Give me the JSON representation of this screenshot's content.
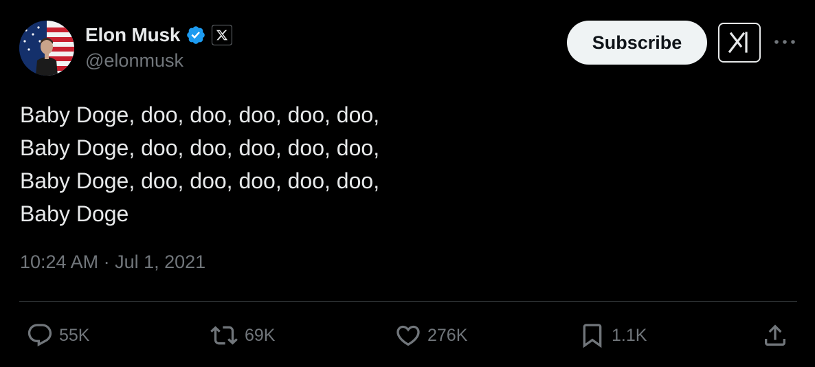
{
  "author": {
    "display_name": "Elon Musk",
    "handle": "@elonmusk",
    "verified_icon": "verified-badge-icon",
    "affiliate_icon": "x-logo-icon"
  },
  "header_actions": {
    "subscribe_label": "Subscribe",
    "grok_icon": "grok-icon",
    "more_icon": "more-dots-icon"
  },
  "tweet": {
    "text": "Baby Doge, doo, doo, doo, doo, doo,\nBaby Doge, doo, doo, doo, doo, doo,\nBaby Doge, doo, doo, doo, doo, doo,\nBaby Doge",
    "timestamp": "10:24 AM · Jul 1, 2021"
  },
  "engagement": {
    "replies": "55K",
    "reposts": "69K",
    "likes": "276K",
    "bookmarks": "1.1K"
  },
  "colors": {
    "background": "#000000",
    "text": "#e7e9ea",
    "secondary": "#71767b",
    "verified": "#1d9bf0",
    "divider": "#2f3336"
  }
}
